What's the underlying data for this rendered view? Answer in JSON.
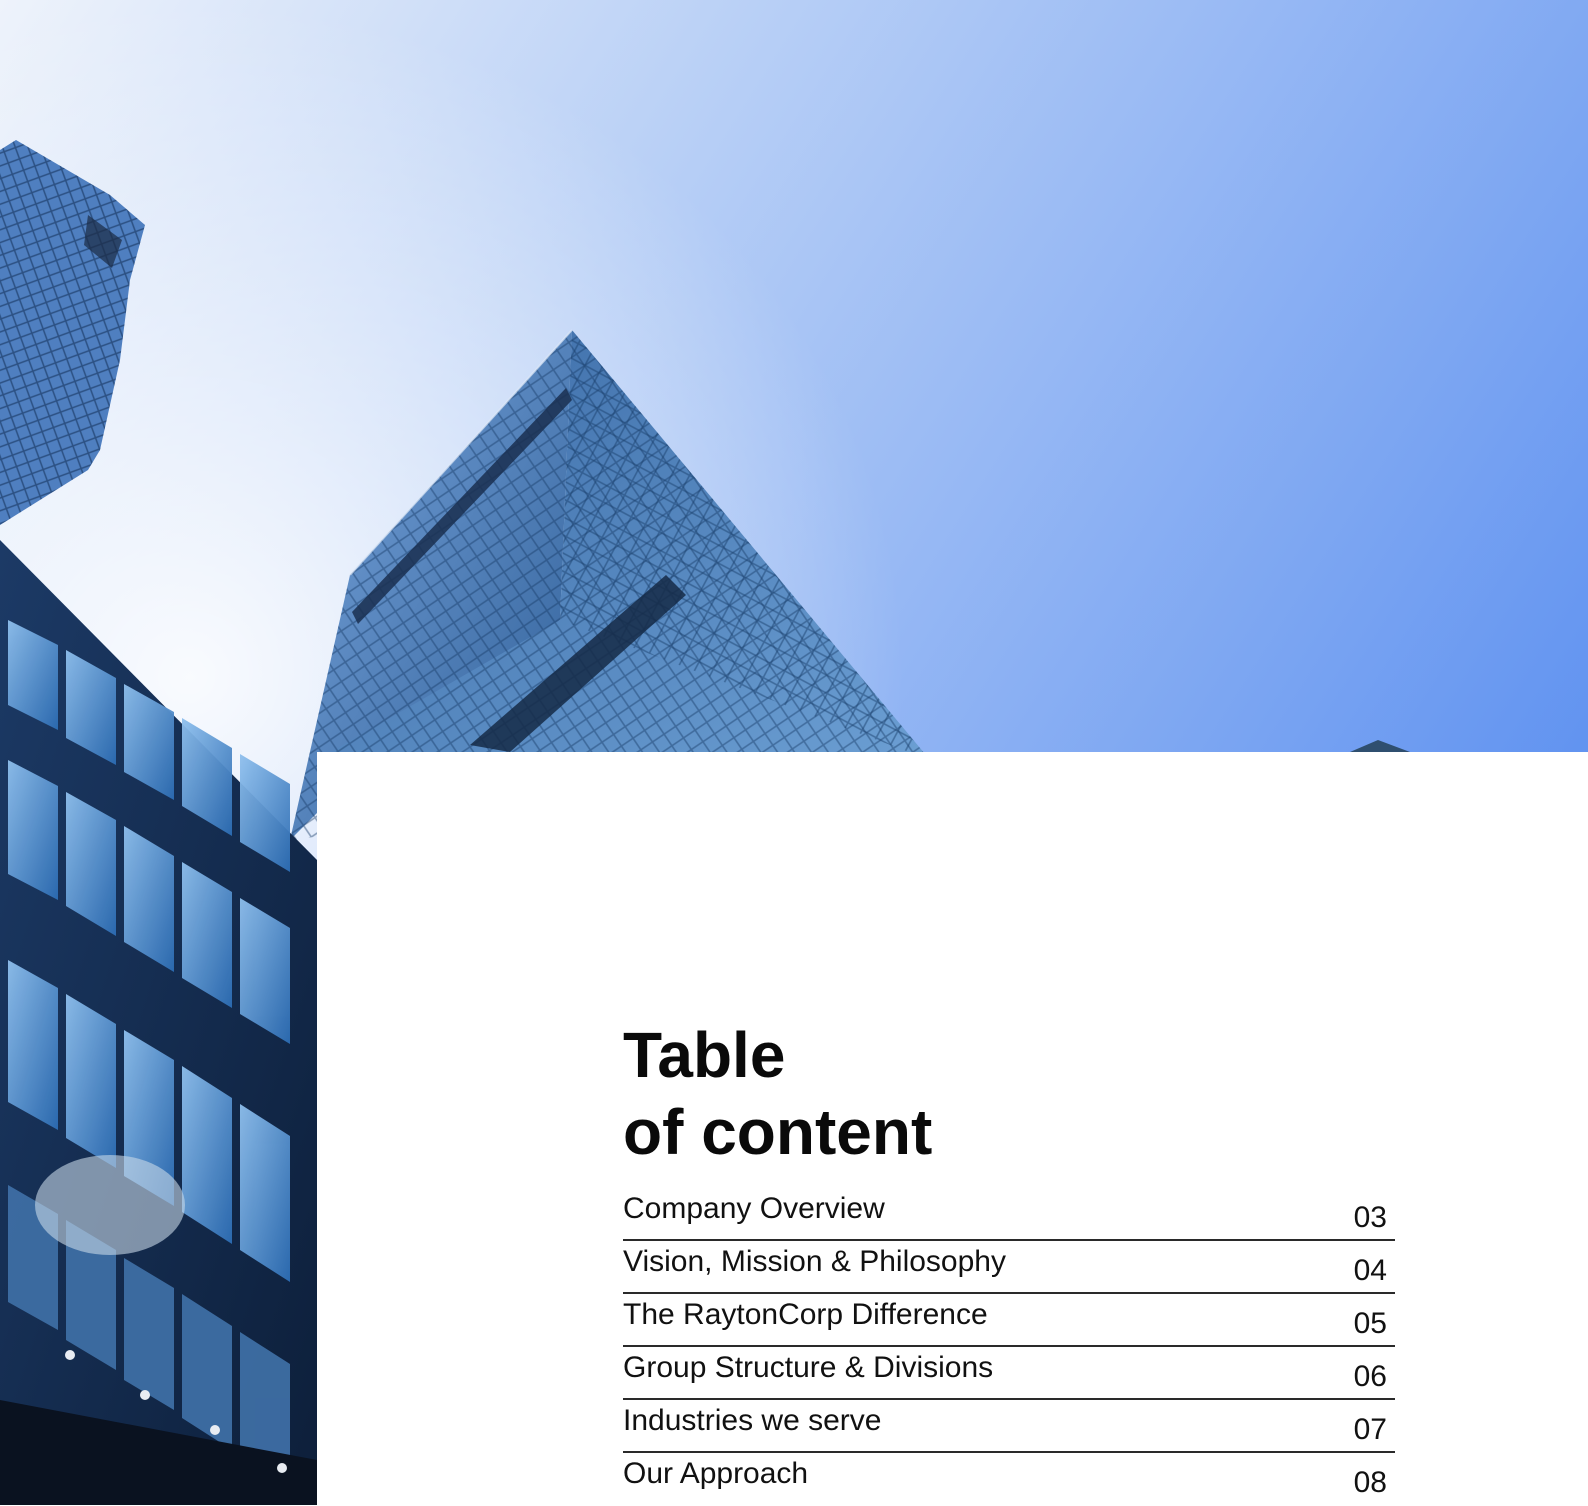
{
  "heading": {
    "line1": "Table",
    "line2": "of content"
  },
  "toc": [
    {
      "label": "Company Overview",
      "page": "03"
    },
    {
      "label": "Vision, Mission & Philosophy",
      "page": "04"
    },
    {
      "label": "The RaytonCorp Difference",
      "page": "05"
    },
    {
      "label": "Group Structure & Divisions",
      "page": "06"
    },
    {
      "label": "Industries we serve",
      "page": "07"
    },
    {
      "label": "Our Approach",
      "page": "08"
    }
  ],
  "colors": {
    "sky_top": "#5b8ff0",
    "sky_light": "#cfe0fb",
    "glass_dark": "#1d3f6e",
    "glass_light": "#6f9fd8",
    "text": "#0a0a0a",
    "rule": "#2a2a2a"
  }
}
